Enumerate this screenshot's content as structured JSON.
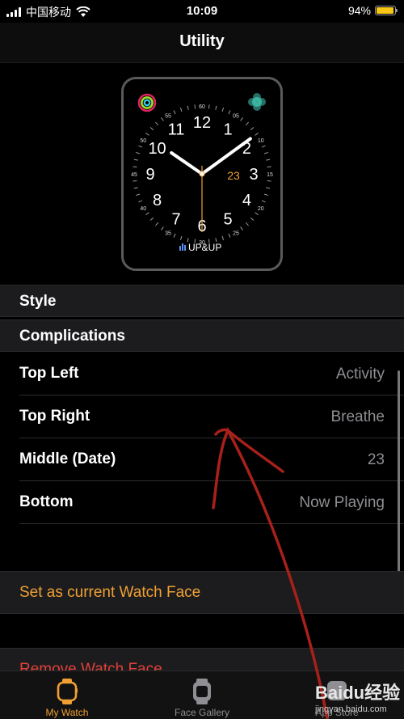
{
  "status_bar": {
    "carrier": "中国移动",
    "time": "10:09",
    "battery_percent": "94%",
    "battery_level": 0.94
  },
  "nav": {
    "title": "Utility"
  },
  "watch_face": {
    "numerals": [
      "12",
      "1",
      "2",
      "3",
      "4",
      "5",
      "6",
      "7",
      "8",
      "9",
      "10",
      "11"
    ],
    "minute_labels": [
      "60",
      "05",
      "10",
      "15",
      "20",
      "25",
      "30",
      "35",
      "40",
      "45",
      "50",
      "55"
    ],
    "date": "23",
    "bottom_text": "UP&UP",
    "time_shown": {
      "hour": 10,
      "minute": 9
    },
    "colors": {
      "accent": "#f0a033",
      "activity": "#e0245e",
      "breathe": "#3fb9a7",
      "hands": "#ffffff"
    }
  },
  "sections": {
    "style": "Style",
    "complications": "Complications"
  },
  "complications": [
    {
      "label": "Top Left",
      "value": "Activity"
    },
    {
      "label": "Top Right",
      "value": "Breathe"
    },
    {
      "label": "Middle (Date)",
      "value": "23"
    },
    {
      "label": "Bottom",
      "value": "Now Playing"
    }
  ],
  "actions": {
    "set_current": "Set as current Watch Face",
    "remove": "Remove Watch Face"
  },
  "tab_bar": {
    "tabs": [
      {
        "label": "My Watch",
        "icon": "watch-icon",
        "active": true
      },
      {
        "label": "Face Gallery",
        "icon": "face-gallery-icon",
        "active": false
      },
      {
        "label": "App Store",
        "icon": "app-store-icon",
        "active": false
      }
    ]
  },
  "watermark": {
    "logo": "Baidu经验",
    "url": "jingyan.baidu.com"
  },
  "colors": {
    "accent": "#f0a033",
    "destructive": "#e0413a",
    "annotation": "#a8201a"
  }
}
